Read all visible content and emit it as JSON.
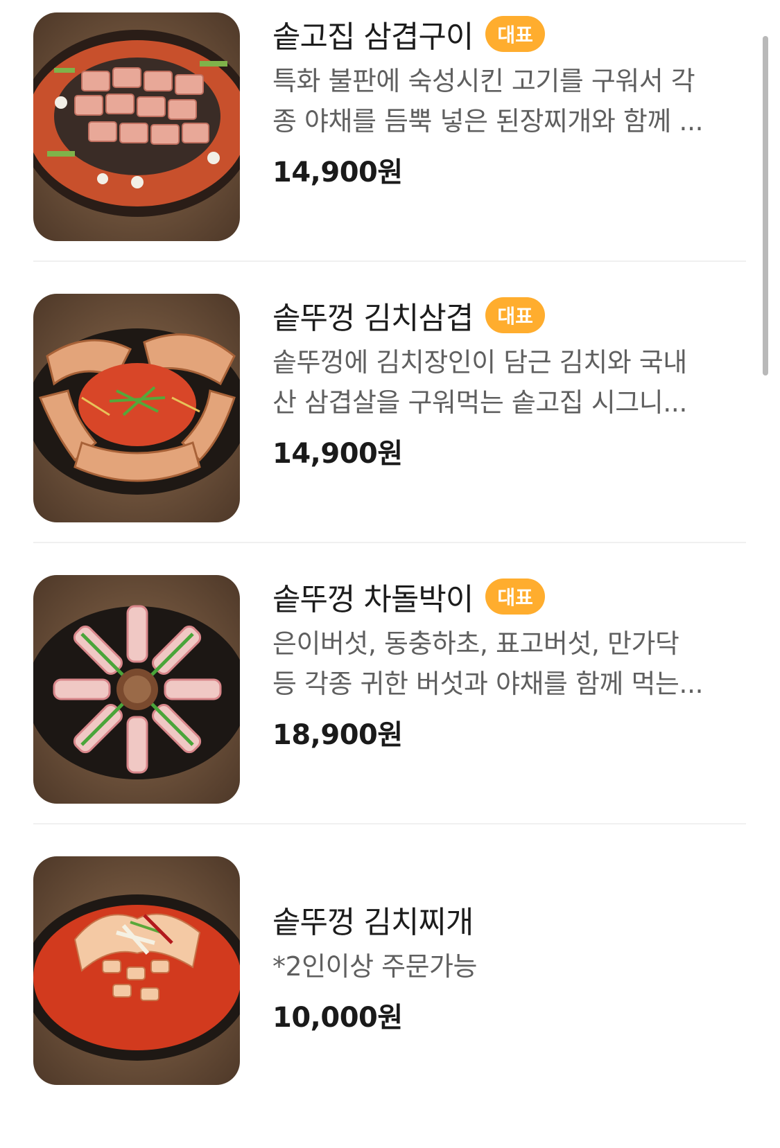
{
  "menu": {
    "items": [
      {
        "name": "솥고집 삼겹구이",
        "badge": "대표",
        "desc_line1": "특화 불판에 숙성시킨 고기를 구워서 각",
        "desc_line2": "종 야채를 듬뿍 넣은 된장찌개와 함께 ...",
        "price": "14,900원",
        "image": "pork-belly-grill-photo"
      },
      {
        "name": "솥뚜껑 김치삼겹",
        "badge": "대표",
        "desc_line1": "솥뚜껑에 김치장인이 담근 김치와 국내",
        "desc_line2": "산 삼겹살을 구워먹는 솥고집 시그니...",
        "price": "14,900원",
        "image": "kimchi-pork-belly-photo"
      },
      {
        "name": "솥뚜껑 차돌박이",
        "badge": "대표",
        "desc_line1": "은이버섯, 동충하초, 표고버섯, 만가닥",
        "desc_line2": "등 각종 귀한 버섯과 야채를 함께 먹는...",
        "price": "18,900원",
        "image": "beef-brisket-mushroom-photo"
      },
      {
        "name": "솥뚜껑 김치찌개",
        "desc_line1": "*2인이상 주문가능",
        "price": "10,000원",
        "image": "kimchi-stew-photo"
      }
    ]
  },
  "colors": {
    "badge": "#ffad2e",
    "title": "#1c1c1c",
    "description": "#5f5f5f",
    "divider": "#f0f0f0"
  }
}
